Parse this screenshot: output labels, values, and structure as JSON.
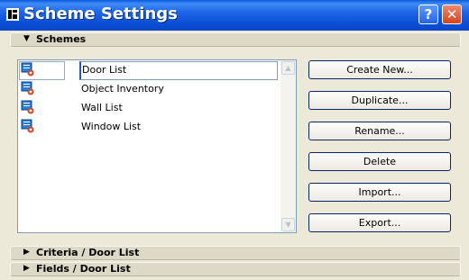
{
  "window": {
    "title": "Scheme Settings",
    "help_label": "?",
    "close_label": "✕"
  },
  "sections": {
    "schemes": "Schemes",
    "criteria": "Criteria / Door List",
    "fields": "Fields / Door List"
  },
  "schemes_list": [
    {
      "label": "Door List",
      "selected": true
    },
    {
      "label": "Object Inventory",
      "selected": false
    },
    {
      "label": "Wall List",
      "selected": false
    },
    {
      "label": "Window List",
      "selected": false
    }
  ],
  "buttons": {
    "create_new": "Create New...",
    "duplicate": "Duplicate...",
    "rename": "Rename...",
    "delete": "Delete",
    "import": "Import...",
    "export": "Export..."
  },
  "icons": {
    "title": "scheme-settings-icon",
    "list_item": "scheme-list-icon"
  },
  "colors": {
    "titlebar": "#1e65e8",
    "dialog_bg": "#ece9d8",
    "selection_border": "#2d56b8"
  }
}
